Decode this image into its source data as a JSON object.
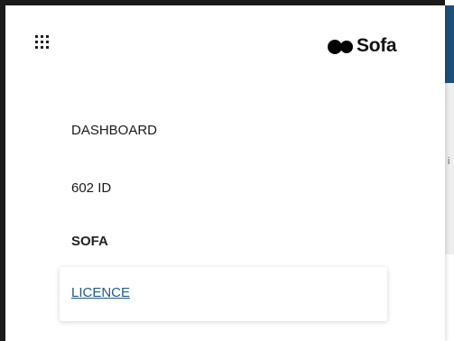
{
  "header": {
    "apps_icon": "apps-grid-icon",
    "logo_text": "Sofa"
  },
  "nav": {
    "items": [
      {
        "label": "DASHBOARD"
      },
      {
        "label": "602 ID"
      },
      {
        "label": "SOFA"
      },
      {
        "label": "LICENCE"
      }
    ]
  },
  "background": {
    "partial_char": "i"
  },
  "colors": {
    "accent": "#1e4f78",
    "link": "#1f5a8b",
    "text": "#1a1a1a"
  }
}
